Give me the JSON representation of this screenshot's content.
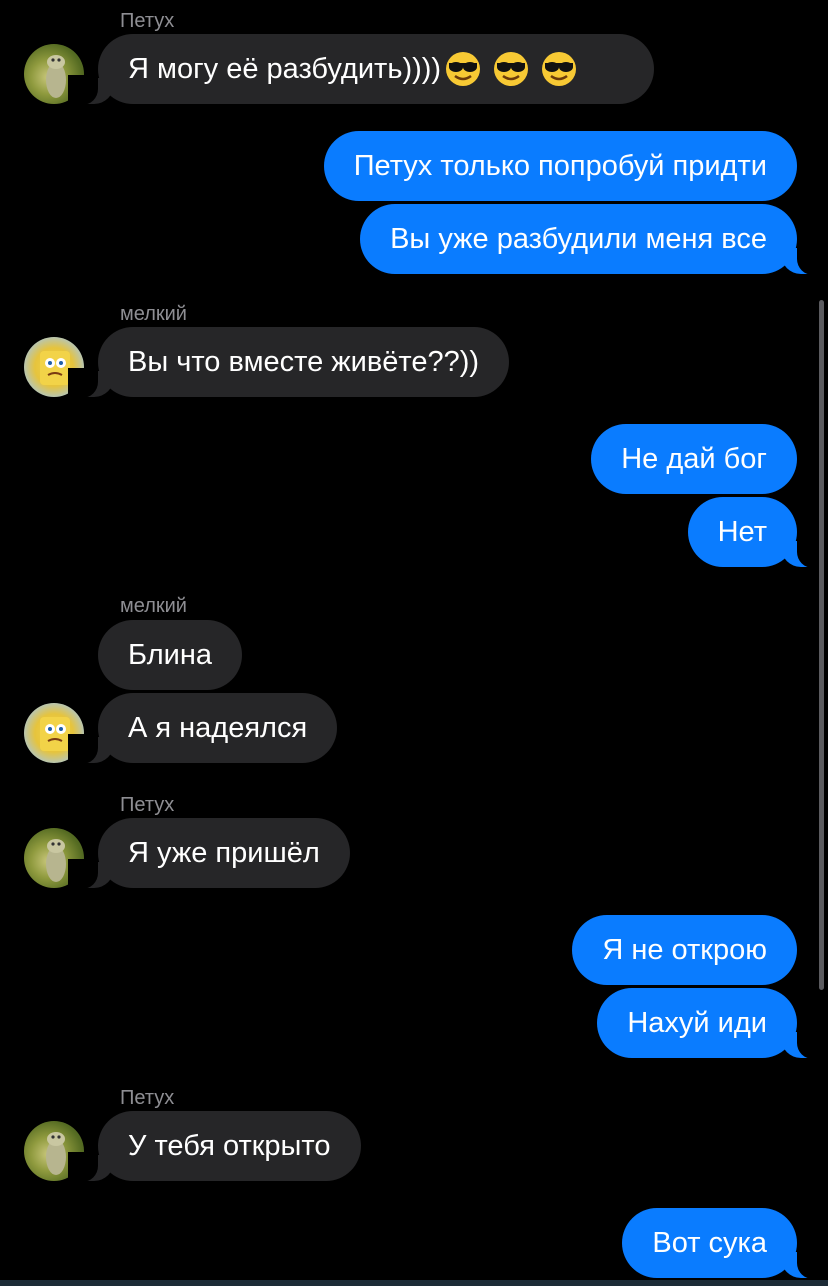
{
  "messages": [
    {
      "sender": "Петух",
      "text": "Я могу её разбудить))))",
      "emoji": [
        "smiling-face-with-sunglasses",
        "smiling-face-with-sunglasses",
        "smiling-face-with-sunglasses"
      ]
    },
    {
      "text": "Петух только попробуй придти"
    },
    {
      "text": "Вы уже разбудили меня все"
    },
    {
      "sender": "мелкий",
      "text": "Вы что вместе живёте??))"
    },
    {
      "text": "Не дай бог"
    },
    {
      "text": "Нет"
    },
    {
      "sender": "мелкий",
      "text": "Блина"
    },
    {
      "text": "А я надеялся"
    },
    {
      "sender": "Петух",
      "text": "Я уже пришёл"
    },
    {
      "text": "Я не открою"
    },
    {
      "text": "Нахуй иди"
    },
    {
      "sender": "Петух",
      "text": "У тебя открыто"
    },
    {
      "text": "Вот сука"
    }
  ],
  "colors": {
    "background": "#000000",
    "incoming_bubble": "#262628",
    "outgoing_bubble": "#0a7cff",
    "sender_name": "#8e8e93",
    "emoji_face": "#f7c934"
  }
}
